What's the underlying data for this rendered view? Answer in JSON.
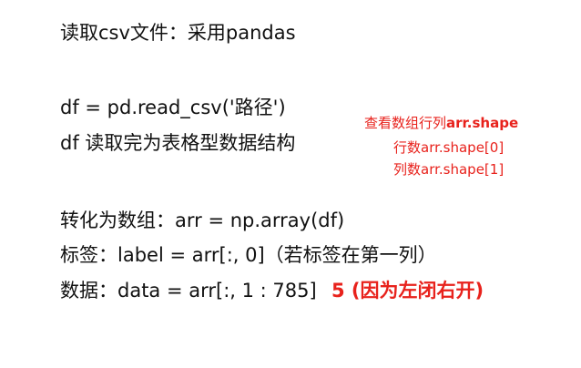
{
  "lines": {
    "l1": "读取csv文件：采用pandas",
    "l2": "df = pd.read_csv('路径')",
    "l3": "df 读取完为表格型数据结构",
    "l4": "转化为数组：arr = np.array(df)",
    "l5": "标签：label = arr[:, 0]（若标签在第一列）",
    "l6": "数据：data = arr[:, 1 : 785]"
  },
  "notes": {
    "shape_prefix": "查看数组行列",
    "shape_code": "arr.shape",
    "rows": "行数arr.shape[0]",
    "cols": "列数arr.shape[1]"
  },
  "annotation": {
    "fix": "5 (因为左闭右开)"
  },
  "colors": {
    "text": "#111111",
    "annotation": "#e8221c"
  }
}
